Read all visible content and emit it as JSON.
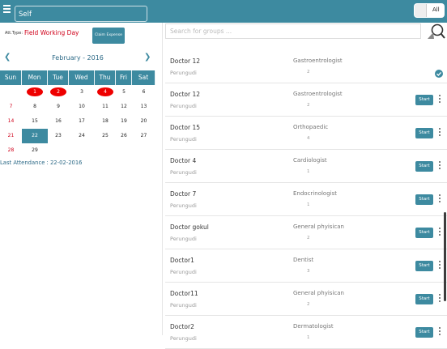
{
  "header": {
    "self_label": "Self",
    "toggle_label": "All"
  },
  "attendance": {
    "type_label": "Att.Type:",
    "type_value": "Field Working Day",
    "claim_button": "Claim Expense"
  },
  "calendar": {
    "month_title": "February - 2016",
    "days_of_week": [
      "Sun",
      "Mon",
      "Tue",
      "Wed",
      "Thu",
      "Fri",
      "Sat"
    ],
    "weeks": [
      [
        "",
        "1",
        "2",
        "3",
        "4",
        "5",
        "6"
      ],
      [
        "7",
        "8",
        "9",
        "10",
        "11",
        "12",
        "13"
      ],
      [
        "14",
        "15",
        "16",
        "17",
        "18",
        "19",
        "20"
      ],
      [
        "21",
        "22",
        "23",
        "24",
        "25",
        "26",
        "27"
      ],
      [
        "28",
        "29",
        "",
        "",
        "",
        "",
        ""
      ]
    ],
    "marked_days": [
      "1",
      "2",
      "4"
    ],
    "today": "22",
    "last_attendance": "Last Attendance : 22-02-2016"
  },
  "search": {
    "placeholder": "Search for groups ..."
  },
  "doctors": [
    {
      "name": "Doctor 12",
      "place": "Perungudi",
      "specialty": "Gastroentrologist",
      "count": "2",
      "action": "check"
    },
    {
      "name": "Doctor 12",
      "place": "Perungudi",
      "specialty": "Gastroentrologist",
      "count": "2",
      "action": "Start"
    },
    {
      "name": "Doctor 15",
      "place": "Perungudi",
      "specialty": "Orthopaedic",
      "count": "4",
      "action": "Start"
    },
    {
      "name": "Doctor 4",
      "place": "Perungudi",
      "specialty": "Cardiologist",
      "count": "1",
      "action": "Start"
    },
    {
      "name": "Doctor 7",
      "place": "Perungudi",
      "specialty": "Endocrinologist",
      "count": "1",
      "action": "Start"
    },
    {
      "name": "Doctor gokul",
      "place": "Perungudi",
      "specialty": "General phyisican",
      "count": "2",
      "action": "Start"
    },
    {
      "name": "Doctor1",
      "place": "Perungudi",
      "specialty": "Dentist",
      "count": "3",
      "action": "Start"
    },
    {
      "name": "Doctor11",
      "place": "Perungudi",
      "specialty": "General phyisican",
      "count": "2",
      "action": "Start"
    },
    {
      "name": "Doctor2",
      "place": "Perungudi",
      "specialty": "Dermatologist",
      "count": "1",
      "action": "Start"
    }
  ],
  "colors": {
    "accent": "#3d8aa0",
    "marked": "#ee0000",
    "sunday": "#d0021b"
  }
}
